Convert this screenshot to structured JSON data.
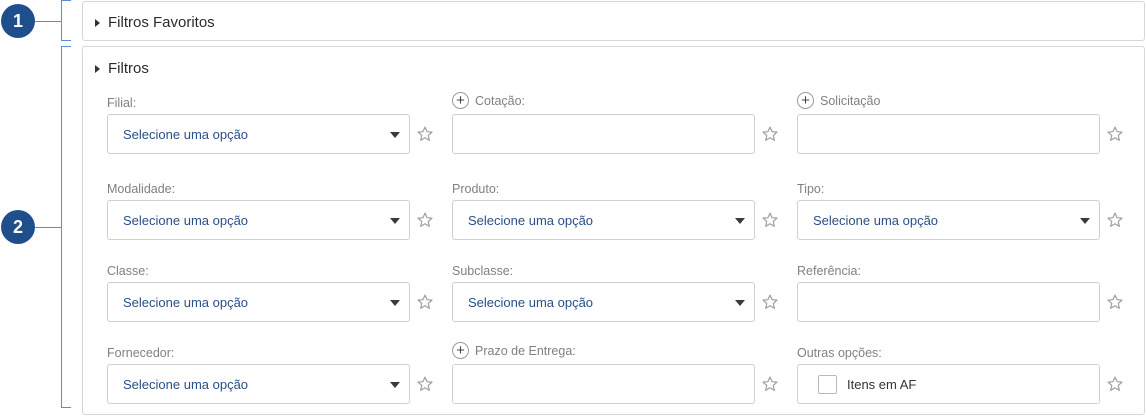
{
  "badges": {
    "one": "1",
    "two": "2"
  },
  "favorites_panel": {
    "title": "Filtros Favoritos"
  },
  "filters_panel": {
    "title": "Filtros",
    "fields": [
      {
        "id": "filial",
        "label": "Filial:",
        "type": "select",
        "value": "Selecione uma opção",
        "plus": false
      },
      {
        "id": "cotacao",
        "label": "Cotação:",
        "type": "input",
        "value": "",
        "plus": true
      },
      {
        "id": "solicitacao",
        "label": "Solicitação",
        "type": "input",
        "value": "",
        "plus": true
      },
      {
        "id": "modalidade",
        "label": "Modalidade:",
        "type": "select",
        "value": "Selecione uma opção",
        "plus": false
      },
      {
        "id": "produto",
        "label": "Produto:",
        "type": "select",
        "value": "Selecione uma opção",
        "plus": false
      },
      {
        "id": "tipo",
        "label": "Tipo:",
        "type": "select",
        "value": "Selecione uma opção",
        "plus": false
      },
      {
        "id": "classe",
        "label": "Classe:",
        "type": "select",
        "value": "Selecione uma opção",
        "plus": false
      },
      {
        "id": "subclasse",
        "label": "Subclasse:",
        "type": "select",
        "value": "Selecione uma opção",
        "plus": false
      },
      {
        "id": "referencia",
        "label": "Referência:",
        "type": "input",
        "value": "",
        "plus": false
      },
      {
        "id": "fornecedor",
        "label": "Fornecedor:",
        "type": "select",
        "value": "Selecione uma opção",
        "plus": false
      },
      {
        "id": "prazo",
        "label": "Prazo de Entrega:",
        "type": "input",
        "value": "",
        "plus": true
      },
      {
        "id": "outras",
        "label": "Outras opções:",
        "type": "checkbox",
        "value": "Itens em AF",
        "checked": false,
        "plus": false
      }
    ]
  },
  "icons": {
    "star": "star-outline-icon",
    "plus": "plus-circle-icon",
    "caret": "caret-right-icon",
    "dropdown": "chevron-down-icon"
  },
  "colors": {
    "badge": "#1f4e8c",
    "bracket": "#5a8fd6",
    "select_text": "#2a4f86"
  }
}
